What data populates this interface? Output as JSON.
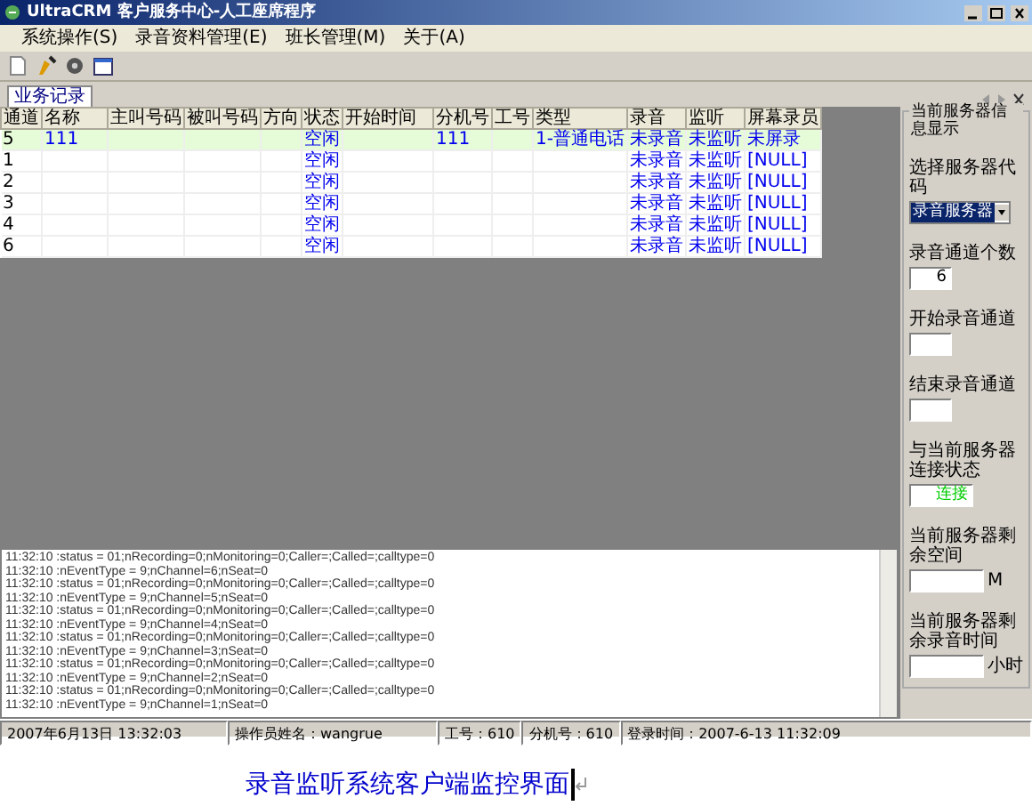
{
  "window": {
    "title": "UltraCRM 客户服务中心-人工座席程序"
  },
  "menu": [
    "系统操作(S)",
    "录音资料管理(E)",
    "班长管理(M)",
    "关于(A)"
  ],
  "tabs": [
    {
      "label": "业务记录",
      "selected": true
    }
  ],
  "table": {
    "columns": [
      "通道",
      "名称",
      "主叫号码",
      "被叫号码",
      "方向",
      "状态",
      "开始时间",
      "分机号",
      "工号",
      "类型",
      "录音",
      "监听",
      "屏幕录员"
    ],
    "rows": [
      {
        "selected": true,
        "cells": [
          "5",
          "111",
          null,
          null,
          null,
          "空闲",
          null,
          "111",
          null,
          "1-普通电话",
          "未录音",
          "未监听",
          "未屏录"
        ]
      },
      {
        "selected": false,
        "cells": [
          "1",
          null,
          null,
          null,
          null,
          "空闲",
          null,
          null,
          null,
          null,
          "未录音",
          "未监听",
          "[NULL]"
        ]
      },
      {
        "selected": false,
        "cells": [
          "2",
          null,
          null,
          null,
          null,
          "空闲",
          null,
          null,
          null,
          null,
          "未录音",
          "未监听",
          "[NULL]"
        ]
      },
      {
        "selected": false,
        "cells": [
          "3",
          null,
          null,
          null,
          null,
          "空闲",
          null,
          null,
          null,
          null,
          "未录音",
          "未监听",
          "[NULL]"
        ]
      },
      {
        "selected": false,
        "cells": [
          "4",
          null,
          null,
          null,
          null,
          "空闲",
          null,
          null,
          null,
          null,
          "未录音",
          "未监听",
          "[NULL]"
        ]
      },
      {
        "selected": false,
        "cells": [
          "6",
          null,
          null,
          null,
          null,
          "空闲",
          null,
          null,
          null,
          null,
          "未录音",
          "未监听",
          "[NULL]"
        ]
      }
    ]
  },
  "server_panel": {
    "title": "当前服务器信息显示",
    "fields": [
      {
        "kind": "select",
        "label": "选择服务器代码",
        "value": "录音服务器"
      },
      {
        "kind": "input",
        "label": "录音通道个数",
        "value": "6"
      },
      {
        "kind": "input",
        "label": "开始录音通道"
      },
      {
        "kind": "input",
        "label": "结束录音通道"
      },
      {
        "kind": "status",
        "label": "与当前服务器连接状态",
        "value": "连接"
      },
      {
        "kind": "input",
        "label": "当前服务器剩余空间",
        "unit": "M"
      },
      {
        "kind": "input",
        "label": "当前服务器剩余录音时间",
        "unit": "小时"
      }
    ]
  },
  "log": [
    "11:32:10 :status = 01;nRecording=0;nMonitoring=0;Caller=;Called=;calltype=0",
    "11:32:10 :nEventType = 9;nChannel=6;nSeat=0",
    "11:32:10 :status = 01;nRecording=0;nMonitoring=0;Caller=;Called=;calltype=0",
    "11:32:10 :nEventType = 9;nChannel=5;nSeat=0",
    "11:32:10 :status = 01;nRecording=0;nMonitoring=0;Caller=;Called=;calltype=0",
    "11:32:10 :nEventType = 9;nChannel=4;nSeat=0",
    "11:32:10 :status = 01;nRecording=0;nMonitoring=0;Caller=;Called=;calltype=0",
    "11:32:10 :nEventType = 9;nChannel=3;nSeat=0",
    "11:32:10 :status = 01;nRecording=0;nMonitoring=0;Caller=;Called=;calltype=0",
    "11:32:10 :nEventType = 9;nChannel=2;nSeat=0",
    "11:32:10 :status = 01;nRecording=0;nMonitoring=0;Caller=;Called=;calltype=0",
    "11:32:10 :nEventType = 9;nChannel=1;nSeat=0"
  ],
  "status_bar": [
    "2007年6月13日 13:32:03",
    "操作员姓名：wangrue",
    "工号：610",
    "分机号：610",
    "登录时间：2007-6-13 11:32:09"
  ],
  "caption": "录音监听系统客户端监控界面"
}
